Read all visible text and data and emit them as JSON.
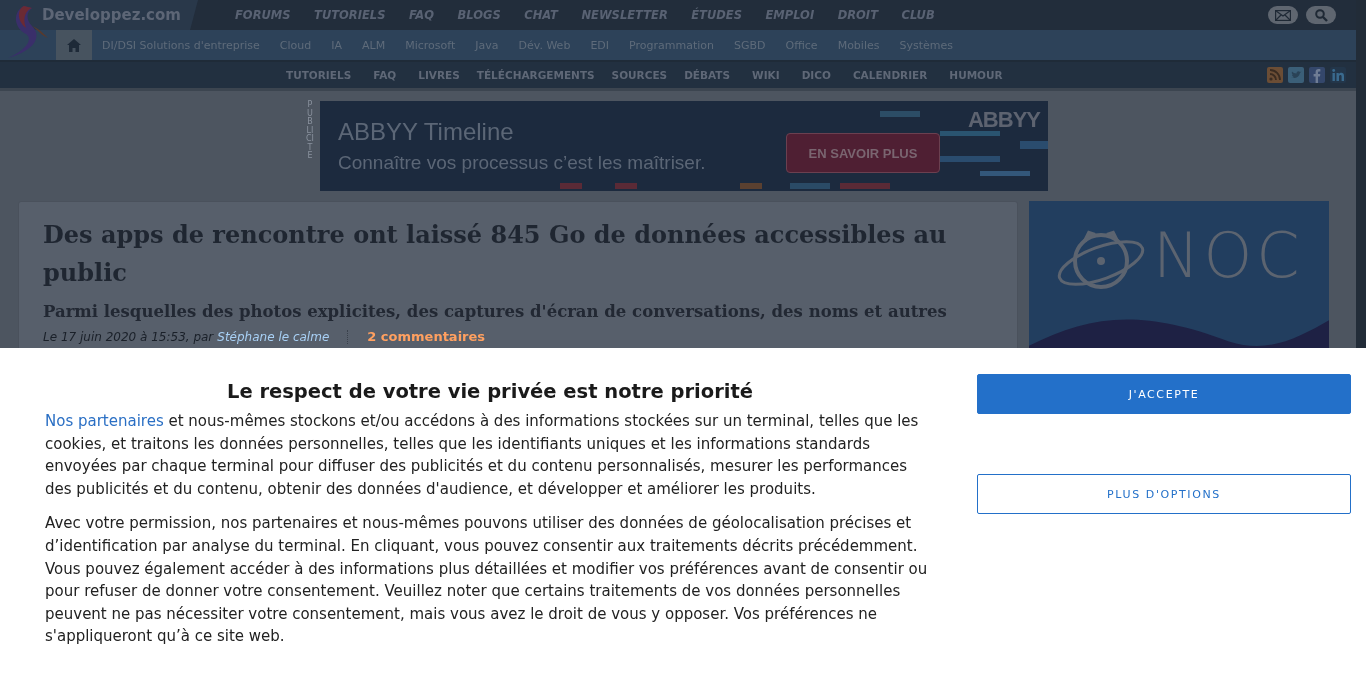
{
  "top_nav": {
    "site_name": "Developpez.com",
    "links": [
      "FORUMS",
      "TUTORIELS",
      "FAQ",
      "BLOGS",
      "CHAT",
      "NEWSLETTER",
      "ÉTUDES",
      "EMPLOI",
      "DROIT",
      "CLUB"
    ]
  },
  "category_nav": [
    "DI/DSI Solutions d'entreprise",
    "Cloud",
    "IA",
    "ALM",
    "Microsoft",
    "Java",
    "Dév. Web",
    "EDI",
    "Programmation",
    "SGBD",
    "Office",
    "Mobiles",
    "Systèmes"
  ],
  "section_nav": [
    "TUTORIELS",
    "FAQ",
    "LIVRES",
    "TÉLÉCHARGEMENTS",
    "SOURCES",
    "DÉBATS",
    "WIKI",
    "DICO",
    "CALENDRIER",
    "HUMOUR"
  ],
  "ad_label": "PUBLICITE",
  "banner": {
    "title": "ABBYY Timeline",
    "tagline": "Connaître vos processus c’est les maîtriser.",
    "button": "EN SAVOIR PLUS",
    "brand": "ABBYY"
  },
  "article": {
    "title": "Des apps de rencontre ont laissé 845 Go de données accessibles au public",
    "subtitle": "Parmi lesquelles des photos explicites, des captures d'écran de conversations, des noms et autres",
    "date": "Le 17 juin 2020 à 15:53, par",
    "author": "Stéphane le calme",
    "comments": "2 commentaires"
  },
  "sidebar_ad": {
    "brand": "NOC"
  },
  "consent": {
    "title": "Le respect de votre vie privée est notre priorité",
    "link": "Nos partenaires",
    "paragraph_1": " et nous-mêmes stockons et/ou accédons à des informations stockées sur un terminal, telles que les cookies, et traitons les données personnelles, telles que les identifiants uniques et les informations standards envoyées par chaque terminal pour diffuser des publicités et du contenu personnalisés, mesurer les performances des publicités et du contenu, obtenir des données d'audience, et développer et améliorer les produits.",
    "paragraph_2": "Avec votre permission, nos partenaires et nous-mêmes pouvons utiliser des données de géolocalisation précises et d’identification par analyse du terminal. En cliquant, vous pouvez consentir aux traitements décrits précédemment. Vous pouvez également accéder à des informations plus détaillées et modifier vos préférences avant de consentir ou pour refuser de donner votre consentement. Veuillez noter que certains traitements de vos données personnelles peuvent ne pas nécessiter votre consentement, mais vous avez le droit de vous y opposer. Vos préférences ne s'appliqueront qu’à ce site web.",
    "accept_button": "J'ACCEPTE",
    "options_button": "PLUS D'OPTIONS"
  }
}
